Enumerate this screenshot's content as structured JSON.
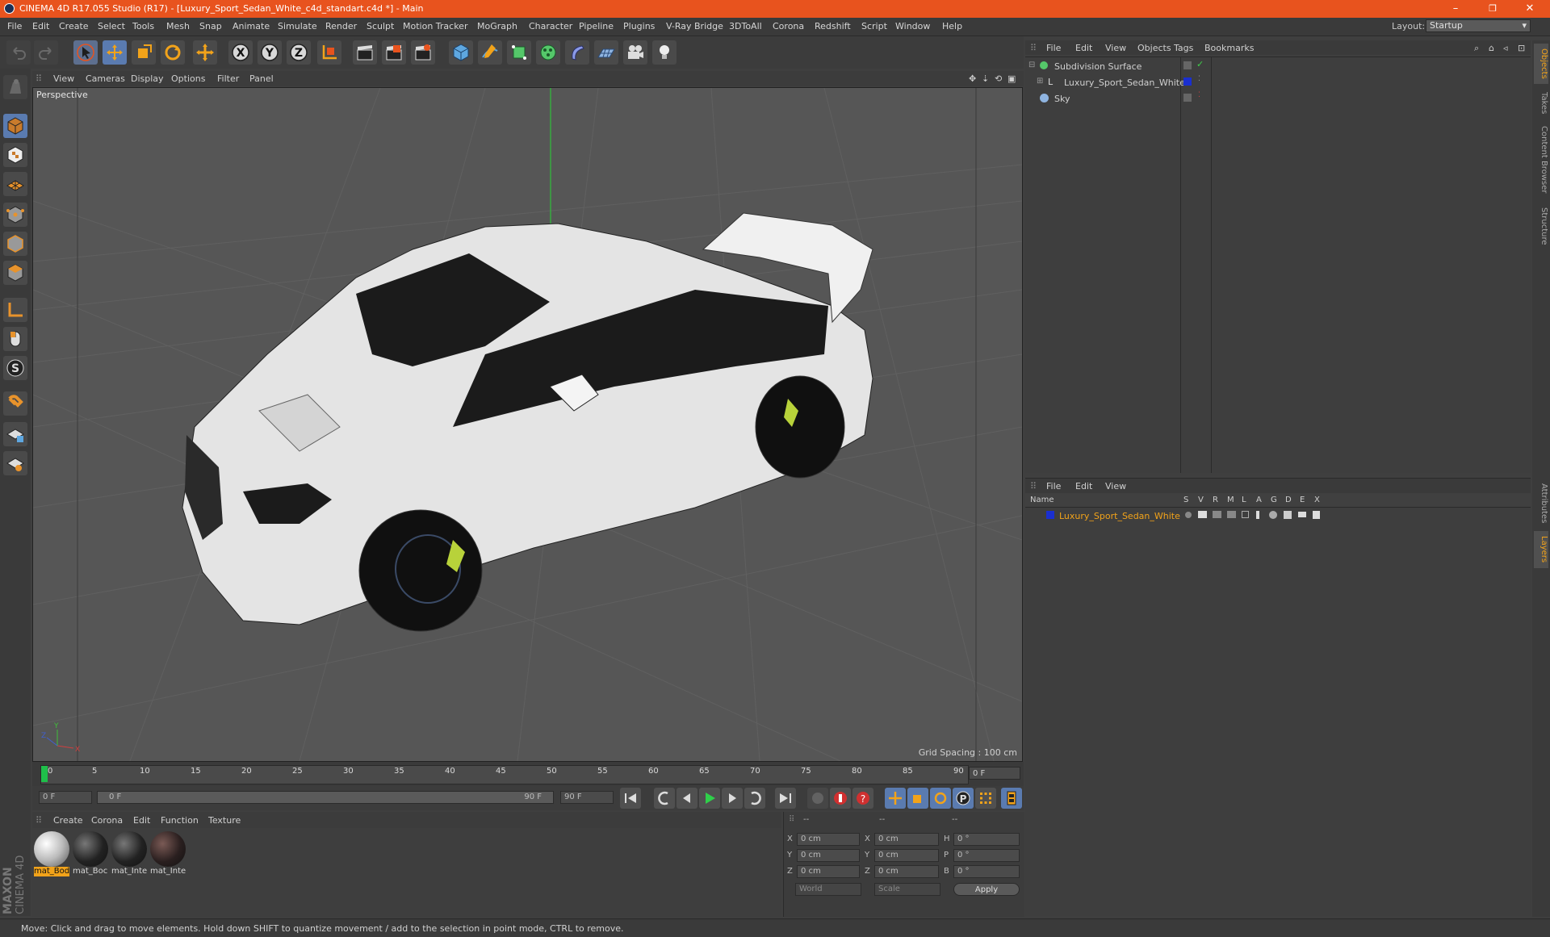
{
  "window": {
    "title": "CINEMA 4D R17.055 Studio (R17) - [Luxury_Sport_Sedan_White_c4d_standart.c4d *] - Main",
    "controls": [
      "–",
      "❐",
      "✕"
    ]
  },
  "menubar": {
    "items": [
      "File",
      "Edit",
      "Create",
      "Select",
      "Tools",
      "Mesh",
      "Snap",
      "Animate",
      "Simulate",
      "Render",
      "Sculpt",
      "Motion Tracker",
      "MoGraph",
      "Character",
      "Pipeline",
      "Plugins",
      "V-Ray Bridge",
      "3DToAll",
      "Corona",
      "Redshift",
      "Script",
      "Window",
      "Help"
    ],
    "layout_label": "Layout:",
    "layout_value": "Startup"
  },
  "viewport": {
    "menu": [
      "View",
      "Cameras",
      "Display",
      "Options",
      "Filter",
      "Panel"
    ],
    "label": "Perspective",
    "grid_spacing": "Grid Spacing : 100 cm"
  },
  "timeline": {
    "ticks": [
      "0",
      "5",
      "10",
      "15",
      "20",
      "25",
      "30",
      "35",
      "40",
      "45",
      "50",
      "55",
      "60",
      "65",
      "70",
      "75",
      "80",
      "85",
      "90"
    ],
    "current_frame": "0 F",
    "start_frame": "0 F",
    "range_start": "0 F",
    "range_end": "90 F",
    "end_frame": "90 F"
  },
  "materials": {
    "menu": [
      "Create",
      "Corona",
      "Edit",
      "Function",
      "Texture"
    ],
    "items": [
      {
        "name": "mat_Bod",
        "selected": true
      },
      {
        "name": "mat_Boc",
        "selected": false
      },
      {
        "name": "mat_Inte",
        "selected": false
      },
      {
        "name": "mat_Inte",
        "selected": false
      }
    ]
  },
  "coordinates": {
    "headers": [
      "--",
      "--",
      "--"
    ],
    "rows": [
      {
        "a": "X",
        "av": "0 cm",
        "b": "X",
        "bv": "0 cm",
        "c": "H",
        "cv": "0 °"
      },
      {
        "a": "Y",
        "av": "0 cm",
        "b": "Y",
        "bv": "0 cm",
        "c": "P",
        "cv": "0 °"
      },
      {
        "a": "Z",
        "av": "0 cm",
        "b": "Z",
        "bv": "0 cm",
        "c": "B",
        "cv": "0 °"
      }
    ],
    "mode": "World",
    "type": "Scale",
    "apply": "Apply"
  },
  "objects": {
    "menu": [
      "File",
      "Edit",
      "View",
      "Objects",
      "Tags",
      "Bookmarks"
    ],
    "tree": [
      {
        "name": "Subdivision Surface",
        "indent": 0
      },
      {
        "name": "Luxury_Sport_Sedan_White",
        "indent": 1
      },
      {
        "name": "Sky",
        "indent": 0
      }
    ]
  },
  "layers": {
    "menu": [
      "File",
      "Edit",
      "View"
    ],
    "columns": [
      "Name",
      "S",
      "V",
      "R",
      "M",
      "L",
      "A",
      "G",
      "D",
      "E",
      "X"
    ],
    "rows": [
      {
        "name": "Luxury_Sport_Sedan_White",
        "color": "#1a2fd0"
      }
    ]
  },
  "side_tabs": [
    "Objects",
    "Takes",
    "Content Browser",
    "Structure",
    "Attributes",
    "Layers"
  ],
  "status": "Move: Click and drag to move elements. Hold down SHIFT to quantize movement / add to the selection in point mode, CTRL to remove.",
  "brand": [
    "MAXON",
    "CINEMA 4D"
  ],
  "colors": {
    "accent": "#e8531e",
    "selection": "#f2a31a",
    "layer_blue": "#1a2fd0"
  }
}
